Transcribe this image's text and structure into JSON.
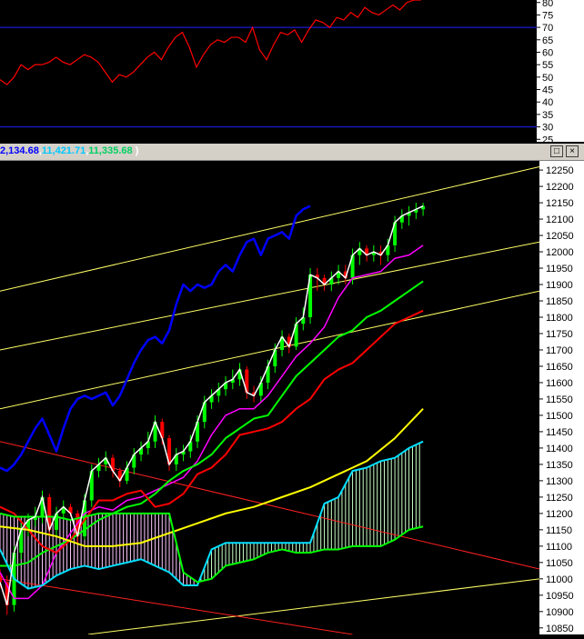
{
  "header": {
    "value_1": "2,134.68",
    "value_2": "11,421.71",
    "value_3": "11,335.68",
    "sep": ",",
    "close_paren": ")",
    "colors": {
      "v1": "#0000ff",
      "v2": "#00c8ff",
      "v3": "#00d060",
      "paren": "#ffffff"
    },
    "maximize_icon": "maximize-icon",
    "close_icon": "close-icon",
    "maximize_glyph": "□",
    "close_glyph": "×"
  },
  "chart_data": [
    {
      "type": "line",
      "y_ticks": [
        80,
        75,
        70,
        65,
        60,
        55,
        50,
        45,
        40,
        35,
        30,
        25
      ],
      "ylim": [
        24,
        81
      ],
      "reference_lines": [
        70,
        30
      ],
      "series": [
        {
          "color": "#ff0000",
          "x": [
            0,
            2,
            4,
            6,
            8,
            10,
            12,
            14,
            16,
            18,
            20,
            22,
            24,
            26,
            28,
            30,
            32,
            34,
            36,
            38,
            40,
            42,
            44,
            46,
            48,
            50,
            52,
            54,
            56,
            58,
            60,
            62,
            64,
            66,
            68,
            70,
            72,
            74,
            76,
            78,
            80,
            82,
            84,
            86,
            88,
            90,
            92,
            94,
            96,
            98,
            100,
            102,
            104,
            106,
            108,
            110,
            112,
            114,
            116,
            118,
            120
          ],
          "values": [
            49,
            47,
            50,
            55,
            53,
            55,
            55,
            56,
            58,
            56,
            55,
            57,
            59,
            58,
            56,
            52,
            48,
            51,
            50,
            52,
            55,
            58,
            60,
            57,
            62,
            66,
            68,
            62,
            54,
            59,
            63,
            65,
            64,
            66,
            66,
            64,
            70,
            61,
            57,
            63,
            68,
            67,
            69,
            64,
            69,
            73,
            72,
            70,
            74,
            73,
            76,
            74,
            78,
            76,
            75,
            77,
            79,
            77,
            80,
            81,
            81
          ]
        }
      ]
    },
    {
      "type": "line",
      "y_ticks": [
        12250,
        12200,
        12150,
        12100,
        12050,
        12000,
        11950,
        11900,
        11850,
        11800,
        11750,
        11700,
        11650,
        11600,
        11550,
        11500,
        11450,
        11400,
        11350,
        11300,
        11250,
        11200,
        11150,
        11100,
        11050,
        11000,
        10950,
        10900,
        10850
      ],
      "ylim": [
        10830,
        12278
      ],
      "xlim": [
        0,
        153
      ],
      "candles": {
        "up_color": "#00ff00",
        "down_color": "#ff0000",
        "x": [
          0,
          2,
          4,
          6,
          8,
          10,
          12,
          14,
          16,
          18,
          20,
          22,
          24,
          26,
          28,
          30,
          32,
          34,
          36,
          38,
          40,
          42,
          44,
          46,
          48,
          50,
          52,
          54,
          56,
          58,
          60,
          62,
          64,
          66,
          68,
          70,
          72,
          74,
          76,
          78,
          80,
          82,
          84,
          86,
          88,
          90,
          92,
          94,
          96,
          98,
          100,
          102,
          104,
          106,
          108,
          110,
          112,
          114,
          116,
          118,
          120
        ],
        "open": [
          11010,
          10990,
          10920,
          11080,
          11150,
          11180,
          11190,
          11250,
          11150,
          11200,
          11220,
          11200,
          11130,
          11240,
          11330,
          11350,
          11370,
          11330,
          11300,
          11340,
          11380,
          11400,
          11420,
          11480,
          11430,
          11350,
          11380,
          11390,
          11420,
          11480,
          11540,
          11560,
          11580,
          11600,
          11610,
          11640,
          11570,
          11560,
          11600,
          11650,
          11700,
          11740,
          11710,
          11780,
          11800,
          11930,
          11920,
          11900,
          11920,
          11940,
          11920,
          11990,
          12010,
          11990,
          12000,
          11990,
          12020,
          12090,
          12110,
          12120,
          12130
        ],
        "close": [
          10990,
          10920,
          11080,
          11150,
          11180,
          11190,
          11250,
          11150,
          11200,
          11220,
          11200,
          11130,
          11240,
          11330,
          11350,
          11370,
          11330,
          11300,
          11340,
          11380,
          11400,
          11420,
          11480,
          11430,
          11350,
          11380,
          11390,
          11420,
          11480,
          11540,
          11560,
          11580,
          11600,
          11610,
          11640,
          11570,
          11560,
          11600,
          11650,
          11700,
          11740,
          11710,
          11780,
          11800,
          11930,
          11920,
          11900,
          11920,
          11940,
          11920,
          11990,
          12010,
          11990,
          12000,
          11990,
          12020,
          12090,
          12110,
          12120,
          12130,
          12140
        ],
        "high": [
          11030,
          11010,
          11100,
          11170,
          11200,
          11220,
          11270,
          11260,
          11220,
          11240,
          11230,
          11210,
          11260,
          11350,
          11370,
          11390,
          11380,
          11340,
          11360,
          11400,
          11420,
          11450,
          11500,
          11490,
          11440,
          11400,
          11410,
          11440,
          11500,
          11560,
          11580,
          11600,
          11620,
          11640,
          11660,
          11650,
          11590,
          11620,
          11670,
          11720,
          11760,
          11750,
          11800,
          11830,
          11950,
          11950,
          11930,
          11940,
          11960,
          11960,
          12010,
          12030,
          12020,
          12020,
          12020,
          12040,
          12110,
          12130,
          12140,
          12150,
          12150
        ],
        "low": [
          10970,
          10890,
          10900,
          11060,
          11130,
          11160,
          11170,
          11130,
          11130,
          11180,
          11190,
          11110,
          11120,
          11220,
          11310,
          11330,
          11310,
          11280,
          11290,
          11320,
          11360,
          11380,
          11400,
          11410,
          11330,
          11330,
          11360,
          11370,
          11400,
          11460,
          11520,
          11540,
          11560,
          11580,
          11590,
          11550,
          11540,
          11540,
          11580,
          11630,
          11680,
          11690,
          11700,
          11760,
          11780,
          11880,
          11880,
          11880,
          11900,
          11900,
          11900,
          11960,
          11970,
          11970,
          11960,
          11970,
          12000,
          12070,
          12080,
          12100,
          12110
        ]
      },
      "series": [
        {
          "color": "#0000ff",
          "width": 2.5,
          "x": [
            0,
            2,
            4,
            6,
            8,
            10,
            12,
            14,
            16,
            18,
            20,
            22,
            24,
            26,
            28,
            30,
            32,
            34,
            36,
            38,
            40,
            42,
            44,
            46,
            48,
            50,
            52,
            54,
            56,
            58,
            60,
            62,
            64,
            66,
            68,
            70,
            72,
            74,
            76,
            78,
            80,
            82,
            84,
            86,
            88
          ],
          "values": [
            11340,
            11330,
            11350,
            11380,
            11420,
            11460,
            11490,
            11440,
            11390,
            11460,
            11520,
            11550,
            11560,
            11550,
            11560,
            11570,
            11530,
            11560,
            11610,
            11660,
            11700,
            11730,
            11740,
            11720,
            11760,
            11840,
            11900,
            11880,
            11900,
            11890,
            11900,
            11940,
            11960,
            11940,
            11990,
            12030,
            12040,
            11990,
            12040,
            12050,
            12060,
            12040,
            12110,
            12130,
            12140
          ]
        },
        {
          "color": "#ff00ff",
          "width": 1.5,
          "x": [
            0,
            4,
            8,
            12,
            16,
            20,
            24,
            28,
            32,
            36,
            40,
            44,
            48,
            52,
            56,
            60,
            64,
            68,
            72,
            76,
            80,
            84,
            88,
            92,
            96,
            100,
            104,
            108,
            112,
            116,
            120
          ],
          "values": [
            11020,
            10940,
            10940,
            10980,
            11080,
            11140,
            11200,
            11220,
            11210,
            11240,
            11250,
            11270,
            11290,
            11310,
            11360,
            11440,
            11500,
            11520,
            11520,
            11560,
            11620,
            11680,
            11720,
            11770,
            11860,
            11920,
            11930,
            11940,
            11980,
            11990,
            12020
          ]
        },
        {
          "color": "#00ff00",
          "width": 2,
          "x": [
            0,
            4,
            8,
            12,
            16,
            20,
            24,
            28,
            32,
            36,
            40,
            44,
            48,
            52,
            56,
            60,
            64,
            68,
            72,
            76,
            80,
            84,
            88,
            92,
            96,
            100,
            104,
            108,
            112,
            116,
            120
          ],
          "values": [
            11040,
            11040,
            11050,
            11080,
            11100,
            11120,
            11150,
            11180,
            11200,
            11220,
            11230,
            11260,
            11300,
            11330,
            11350,
            11380,
            11430,
            11460,
            11490,
            11500,
            11560,
            11620,
            11660,
            11700,
            11740,
            11760,
            11800,
            11820,
            11850,
            11880,
            11910
          ]
        },
        {
          "color": "#ff0000",
          "width": 2,
          "x": [
            0,
            4,
            8,
            12,
            16,
            20,
            24,
            28,
            32,
            36,
            40,
            44,
            48,
            52,
            56,
            60,
            64,
            68,
            72,
            76,
            80,
            84,
            88,
            92,
            96,
            100,
            104,
            108,
            112,
            116,
            120
          ],
          "values": [
            11220,
            11200,
            11150,
            11100,
            11080,
            11120,
            11180,
            11240,
            11240,
            11260,
            11270,
            11220,
            11230,
            11260,
            11320,
            11340,
            11380,
            11440,
            11450,
            11460,
            11480,
            11520,
            11550,
            11610,
            11640,
            11660,
            11700,
            11740,
            11780,
            11800,
            11820
          ]
        },
        {
          "color": "#ffff00",
          "width": 2,
          "x": [
            0,
            8,
            16,
            24,
            32,
            40,
            48,
            56,
            64,
            72,
            80,
            88,
            96,
            104,
            112,
            120
          ],
          "values": [
            11160,
            11150,
            11130,
            11100,
            11100,
            11110,
            11140,
            11170,
            11200,
            11220,
            11250,
            11280,
            11320,
            11360,
            11430,
            11520
          ]
        },
        {
          "color": "#00e0ff",
          "width": 2,
          "x": [
            0,
            4,
            8,
            12,
            16,
            20,
            24,
            28,
            32,
            36,
            40,
            44,
            48,
            52,
            56,
            60,
            64,
            68,
            72,
            76,
            80,
            84,
            88,
            92,
            96,
            100,
            104,
            108,
            112,
            116,
            120
          ],
          "values": [
            11090,
            11000,
            10970,
            10980,
            11010,
            11030,
            11040,
            11030,
            11040,
            11050,
            11060,
            11040,
            11020,
            10980,
            10980,
            11090,
            11110,
            11110,
            11110,
            11110,
            11110,
            11110,
            11110,
            11230,
            11250,
            11330,
            11340,
            11360,
            11370,
            11400,
            11420
          ]
        },
        {
          "color": "#00ff00",
          "width": 2,
          "x": [
            0,
            4,
            8,
            12,
            16,
            20,
            24,
            28,
            32,
            36,
            40,
            44,
            48,
            52,
            56,
            60,
            64,
            68,
            72,
            76,
            80,
            84,
            88,
            92,
            96,
            100,
            104,
            108,
            112,
            116,
            120
          ],
          "values": [
            11200,
            11190,
            11190,
            11190,
            11190,
            11180,
            11190,
            11200,
            11200,
            11200,
            11200,
            11200,
            11200,
            11020,
            10990,
            11000,
            11040,
            11050,
            11060,
            11080,
            11090,
            11080,
            11080,
            11090,
            11090,
            11100,
            11100,
            11100,
            11120,
            11150,
            11160
          ]
        }
      ],
      "trend_lines": [
        {
          "color": "#ffff66",
          "from": [
            0,
            11880
          ],
          "to": [
            153,
            12260
          ]
        },
        {
          "color": "#ffff66",
          "from": [
            0,
            11700
          ],
          "to": [
            153,
            12030
          ]
        },
        {
          "color": "#ffff66",
          "from": [
            0,
            11520
          ],
          "to": [
            153,
            11880
          ]
        },
        {
          "color": "#ffff66",
          "from": [
            25,
            10830
          ],
          "to": [
            153,
            11000
          ]
        },
        {
          "color": "#ff2020",
          "from": [
            0,
            11420
          ],
          "to": [
            153,
            11030
          ]
        },
        {
          "color": "#ff2020",
          "from": [
            0,
            11000
          ],
          "to": [
            100,
            10830
          ]
        }
      ]
    }
  ]
}
